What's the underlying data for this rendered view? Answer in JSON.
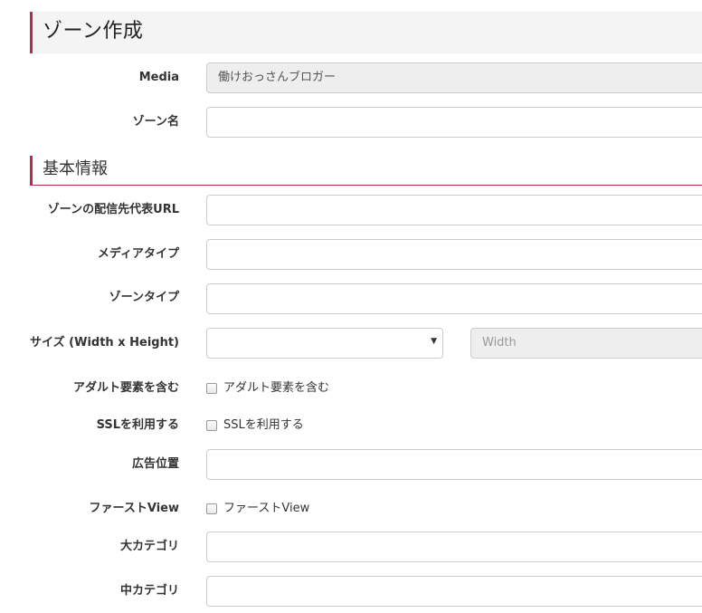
{
  "page": {
    "title": "ゾーン作成"
  },
  "section": {
    "title": "基本情報"
  },
  "fields": {
    "media": {
      "label": "Media",
      "value": "働けおっさんブロガー"
    },
    "zone_name": {
      "label": "ゾーン名",
      "value": ""
    },
    "zone_url": {
      "label": "ゾーンの配信先代表URL",
      "value": ""
    },
    "media_type": {
      "label": "メディアタイプ",
      "value": ""
    },
    "zone_type": {
      "label": "ゾーンタイプ",
      "value": ""
    },
    "size": {
      "label": "サイズ (Width x Height)",
      "selected": "",
      "caret": "▼",
      "width_placeholder": "Width"
    },
    "adult": {
      "label": "アダルト要素を含む",
      "checkbox_label": "アダルト要素を含む",
      "checked": false
    },
    "ssl": {
      "label": "SSLを利用する",
      "checkbox_label": "SSLを利用する",
      "checked": false
    },
    "ad_position": {
      "label": "広告位置",
      "value": ""
    },
    "first_view": {
      "label": "ファーストView",
      "checkbox_label": "ファーストView",
      "checked": false
    },
    "major_category": {
      "label": "大カテゴリ",
      "value": ""
    },
    "middle_category": {
      "label": "中カテゴリ",
      "value": ""
    }
  },
  "colors": {
    "accent": "#c0284a",
    "header_bg": "#f4f4f4",
    "readonly_bg": "#eeeeee"
  }
}
